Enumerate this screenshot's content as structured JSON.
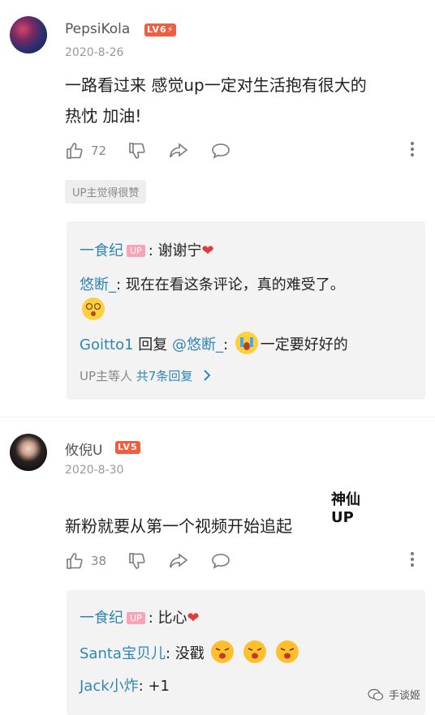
{
  "comments": [
    {
      "username": "PepsiKola",
      "level": "LV6⚡",
      "date": "2020-8-26",
      "text_line1": "一路看过来 感觉up一定对生活抱有很大的",
      "text_line2": "热忱 加油!",
      "likes": "72",
      "up_liked": "UP主觉得很赞",
      "replies": [
        {
          "name": "一食纪",
          "up_tag": "UP",
          "text": ": 谢谢宁",
          "emoji": "❤️"
        },
        {
          "name": "悠断_",
          "text": ": 现在在看这条评论，真的难受了。"
        },
        {
          "name": "Goitto1",
          "text_before": " 回复 ",
          "mention": "@悠断_",
          "text_after": ": ",
          "text_tail": "一定要好好的"
        }
      ],
      "reply_summary_prefix": "UP主等人 ",
      "reply_summary_link": "共7条回复"
    },
    {
      "username": "攸倪U",
      "level": "LV5",
      "date": "2020-8-30",
      "text": "新粉就要从第一个视频开始追起",
      "sticker_line1": "神仙",
      "sticker_line2": "UP",
      "likes": "38",
      "replies": [
        {
          "name": "一食纪",
          "up_tag": "UP",
          "text": ": 比心"
        },
        {
          "name": "Santa宝贝儿",
          "text": ": 没戳"
        },
        {
          "name": "Jack小炸",
          "text": ": +1"
        }
      ]
    }
  ],
  "watermark": "手谈姬"
}
